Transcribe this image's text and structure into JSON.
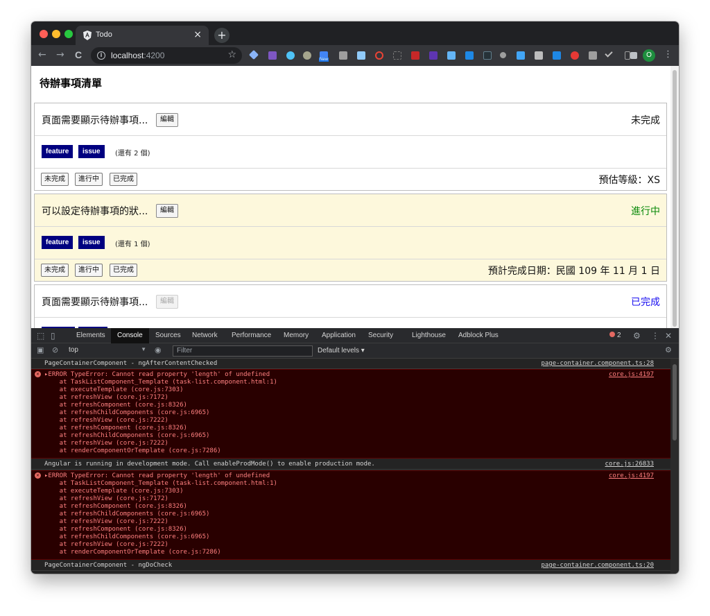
{
  "browser": {
    "tab_title": "Todo",
    "tab_close": "×",
    "new_tab": "+",
    "url_host": "localhost",
    "url_port": ":4200",
    "back": "←",
    "forward": "→",
    "reload": "C",
    "star": "☆",
    "new_badge": "New",
    "profile_initial": "O"
  },
  "page": {
    "title": "待辦事項清單",
    "edit_label": "編輯",
    "state_buttons": [
      "未完成",
      "進行中",
      "已完成"
    ],
    "tasks": [
      {
        "name": "頁面需要顯示待辦事項...",
        "status": "未完成",
        "status_color": "#111111",
        "tags": [
          "feature",
          "issue"
        ],
        "remaining": "(還有 2 個)",
        "meta": "預估等級：XS"
      },
      {
        "name": "可以設定待辦事項的狀...",
        "status": "進行中",
        "status_color": "#0a8a0a",
        "tags": [
          "feature",
          "issue"
        ],
        "remaining": "(還有 1 個)",
        "meta": "預計完成日期：民國 109 年 11 月 1 日"
      },
      {
        "name": "頁面需要顯示待辦事項...",
        "status": "已完成",
        "status_color": "#1a0ff0",
        "edit_disabled": true
      }
    ]
  },
  "devtools": {
    "tabs": [
      "Elements",
      "Console",
      "Sources",
      "Network",
      "Performance",
      "Memory",
      "Application",
      "Security",
      "Lighthouse",
      "Adblock Plus"
    ],
    "active_tab": "Console",
    "error_count": "2",
    "context": "top",
    "filter_placeholder": "Filter",
    "levels": "Default levels ▾",
    "messages": [
      {
        "type": "log",
        "text": "PageContainerComponent - ngAfterContentChecked",
        "source": "page-container.component.ts:28"
      },
      {
        "type": "error",
        "source": "core.js:4197",
        "lines": [
          "▸ERROR TypeError: Cannot read property 'length' of undefined",
          "    at TaskListComponent_Template (task-list.component.html:1)",
          "    at executeTemplate (core.js:7303)",
          "    at refreshView (core.js:7172)",
          "    at refreshComponent (core.js:8326)",
          "    at refreshChildComponents (core.js:6965)",
          "    at refreshView (core.js:7222)",
          "    at refreshComponent (core.js:8326)",
          "    at refreshChildComponents (core.js:6965)",
          "    at refreshView (core.js:7222)",
          "    at renderComponentOrTemplate (core.js:7286)"
        ]
      },
      {
        "type": "log",
        "text": "Angular is running in development mode. Call enableProdMode() to enable production mode.",
        "source": "core.js:26833"
      },
      {
        "type": "error",
        "source": "core.js:4197",
        "lines": [
          "▸ERROR TypeError: Cannot read property 'length' of undefined",
          "    at TaskListComponent_Template (task-list.component.html:1)",
          "    at executeTemplate (core.js:7303)",
          "    at refreshView (core.js:7172)",
          "    at refreshComponent (core.js:8326)",
          "    at refreshChildComponents (core.js:6965)",
          "    at refreshView (core.js:7222)",
          "    at refreshComponent (core.js:8326)",
          "    at refreshChildComponents (core.js:6965)",
          "    at refreshView (core.js:7222)",
          "    at renderComponentOrTemplate (core.js:7286)"
        ]
      },
      {
        "type": "log",
        "text": "PageContainerComponent - ngDoCheck",
        "source": "page-container.component.ts:20"
      }
    ]
  }
}
